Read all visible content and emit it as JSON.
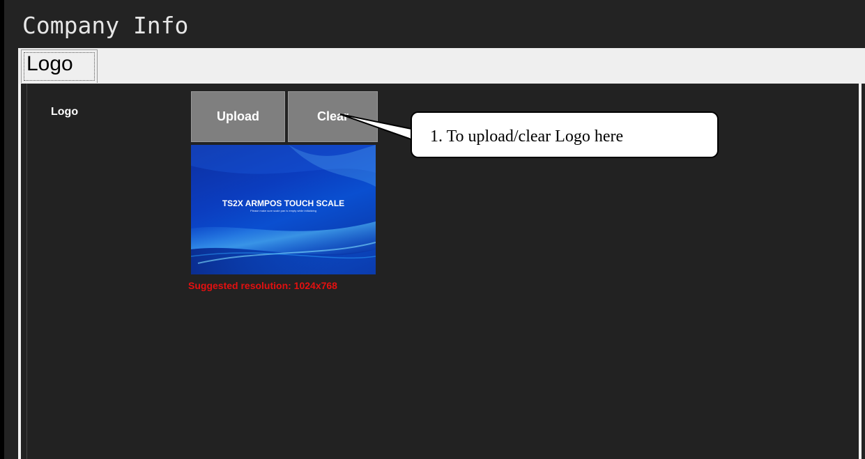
{
  "window": {
    "title": "Company Info"
  },
  "tabs": [
    {
      "label": "Logo",
      "selected": true
    }
  ],
  "logo_section": {
    "label": "Logo",
    "upload_label": "Upload",
    "clear_label": "Clear",
    "preview": {
      "title": "TS2X ARMPOS TOUCH SCALE",
      "subtitle": "Please make sure scale pan is empty while initializing"
    },
    "resolution_note": "Suggested resolution: 1024x768"
  },
  "callout": {
    "text": "1. To upload/clear Logo here"
  },
  "colors": {
    "background": "#232323",
    "button": "#7f7f7f",
    "note": "#e41010",
    "tab_strip": "#efefef"
  }
}
